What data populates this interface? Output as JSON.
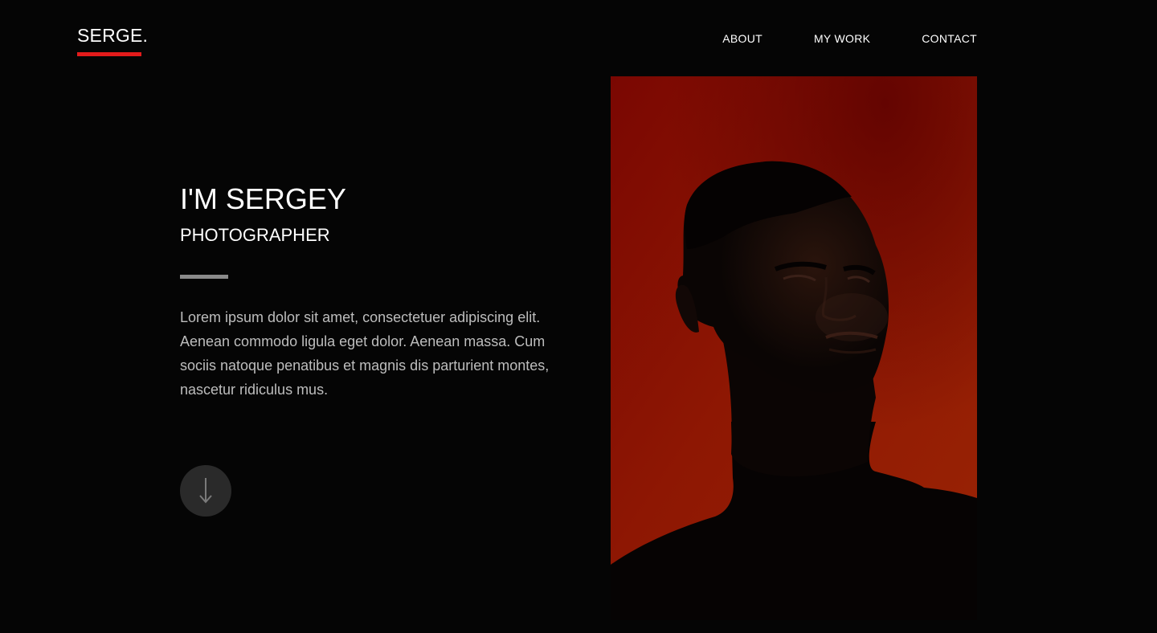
{
  "header": {
    "logo": "SERGE.",
    "nav": [
      {
        "label": "ABOUT"
      },
      {
        "label": "MY WORK"
      },
      {
        "label": "CONTACT"
      }
    ]
  },
  "hero": {
    "title": "I'M SERGEY",
    "subtitle": "PHOTOGRAPHER",
    "body": "Lorem ipsum dolor sit amet, consectetuer adipiscing elit. Aenean commodo ligula eget dolor. Aenean massa. Cum sociis natoque penatibus et magnis dis parturient montes, nascetur ridiculus mus.",
    "scroll_icon": "arrow-down-icon"
  },
  "colors": {
    "background": "#050505",
    "accent": "#e31b1b",
    "portrait_background": "#8f1c02"
  }
}
